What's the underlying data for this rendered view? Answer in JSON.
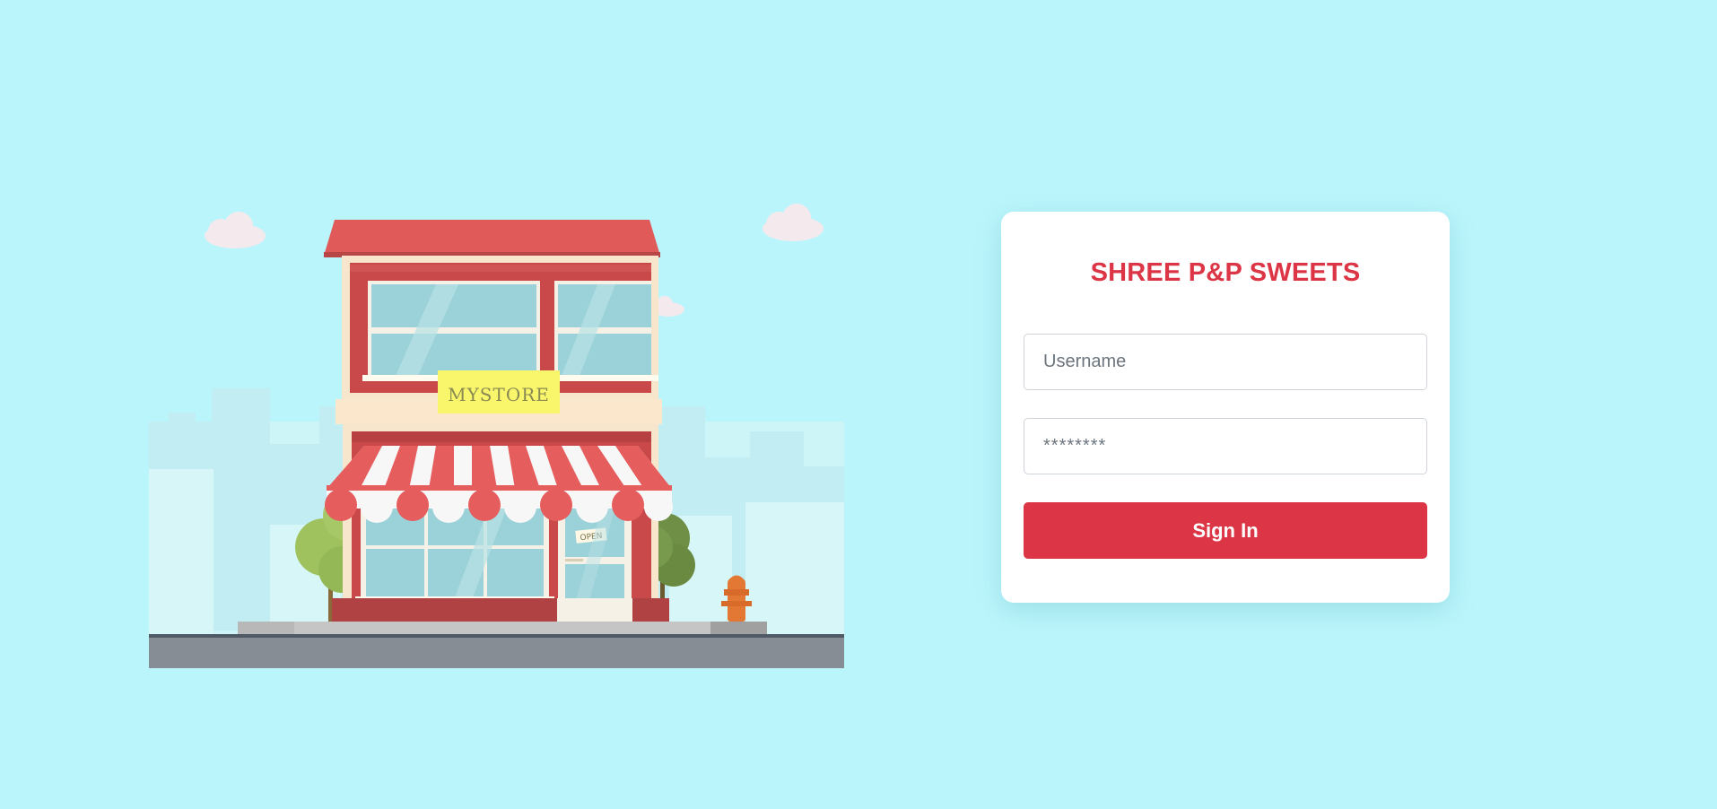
{
  "illustration": {
    "store_sign": "MYSTORE",
    "door_sign": "OPEN"
  },
  "login": {
    "title": "SHREE P&P SWEETS",
    "username_placeholder": "Username",
    "password_display": "********",
    "signin_label": "Sign In"
  },
  "colors": {
    "background": "#baf5fb",
    "accent": "#dc3545",
    "card": "#ffffff"
  },
  "icons": [
    "cloud-icon",
    "tree-icon",
    "fire-hydrant-icon"
  ]
}
